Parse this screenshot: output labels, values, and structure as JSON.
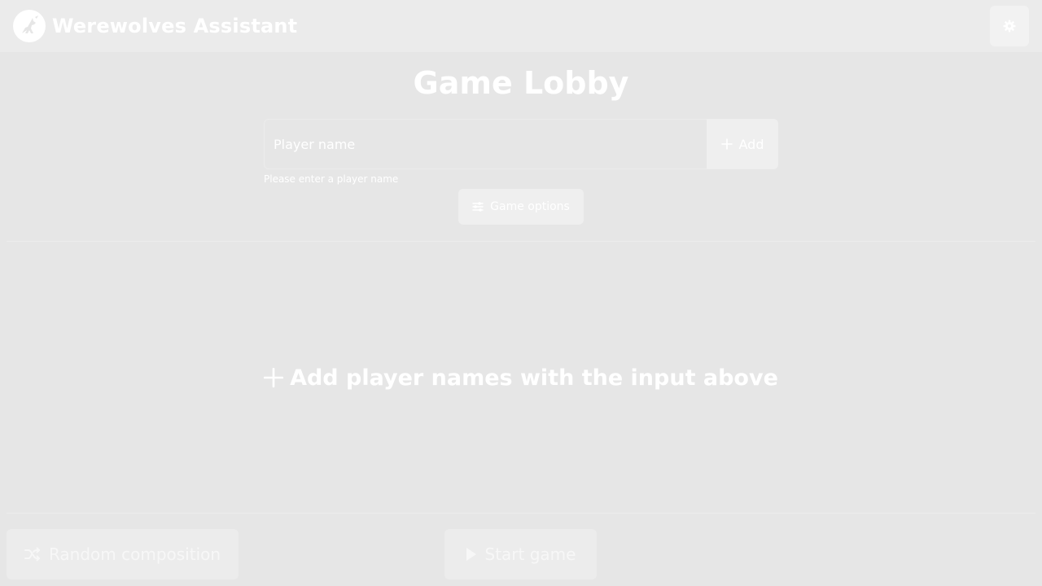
{
  "header": {
    "app_title": "Werewolves Assistant",
    "logo_icon": "wolf-howl-icon",
    "settings_icon": "gear-icon"
  },
  "lobby": {
    "title": "Game Lobby",
    "player_input": {
      "placeholder": "Player name",
      "value": ""
    },
    "add_button_label": "Add",
    "validation_hint": "Please enter a player name",
    "game_options_label": "Game options",
    "empty_players_message": "Add player names with the input above"
  },
  "footer": {
    "random_composition_label": "Random composition",
    "start_game_label": "Start game"
  },
  "colors": {
    "background": "#e6e6e6",
    "header_background": "#ebebeb",
    "text": "#ffffff"
  }
}
